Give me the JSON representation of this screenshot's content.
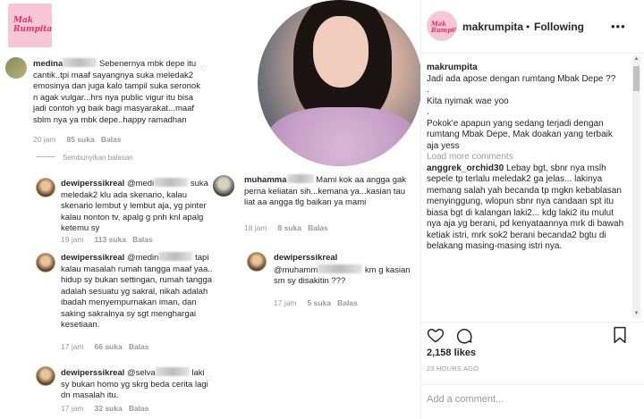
{
  "brand": {
    "logo_text": "Mak Rumpita",
    "pink": "#f7c6d6",
    "accent": "#e0306b"
  },
  "left_comments": [
    {
      "user": "medina",
      "text": "Sebenernya mbk depe itu cantik..tpi maaf sayangnya suka meledak2 emosinya dan juga kalo tampil suka seronok n agak vulgar...hrs nya public vigur itu bisa jadi contoh yg baik bagi masyarakat...maaf sblm nya ya mbk depe..happy ramadhan",
      "time": "20 jam",
      "likes": "85 suka",
      "reply": "Balas"
    },
    {
      "user": "dewiperssikreal",
      "mention": "@medi",
      "text": "suka meledak2 klu ada skenario, kalau skenario lembut y lembut aja, yg pinter kalau nonton tv, apalg g pnh knl apalg ketemu sy",
      "time": "19 jam",
      "likes": "113 suka",
      "reply": "Balas"
    },
    {
      "user": "dewiperssikreal",
      "mention": "@medin",
      "text": "tapi kalau masalah rumah tangga maaf yaa.. hidup sy bukan settingan, rumah tangga adalah sesuatu yg sakral, nikah adalah ibadah menyempurnakan iman, dan saking sakralnya sy sgt menghargai kesetiaan.",
      "time": "17 jam",
      "likes": "66 suka",
      "reply": "Balas"
    },
    {
      "user": "dewiperssikreal",
      "mention": "@selva",
      "text": "laki sy bukan homo yg skrg beda cerita lagi dn masalah itu.",
      "time": "17 jam",
      "likes": "32 suka",
      "reply": "Balas"
    }
  ],
  "hide_replies": "Sembunyikan balasan",
  "middle_comments": [
    {
      "user": "muhamma",
      "text": "Mami kok aa angga gak perna keliatan sih...kemana ya...kasian tau liat aa angga tlg baikan ya mami",
      "time": "18 jam",
      "likes": "8 suka",
      "reply": "Balas"
    },
    {
      "user": "dewiperssikreal",
      "mention": "@muhamm",
      "text": "km g kasian sm sy disakitin ???",
      "time": "17 jam",
      "likes": "5 suka",
      "reply": "Balas"
    }
  ],
  "post": {
    "username": "makrumpita",
    "separator": "•",
    "follow_state": "Following",
    "more": "•••",
    "caption_user": "makrumpita",
    "caption_lines": [
      "Jadi ada apose dengan rumtang Mbak Depe ??",
      ".",
      "Kita nyimak wae yoo",
      ".",
      "Pokok'e apapun yang sedang terjadi dengan rumtang Mbak Depe, Mak doakan yang terbaik aja yess"
    ],
    "load_more": "Load more comments",
    "comment_user": "anggrek_orchid30",
    "comment_text": "Lebay bgt, sbnr nya mslh sepele tp terlalu meledak2 ga jelas... lakinya memang salah yah becanda tp mgkn kebablasan menyinggung, wlopun sbnr nya candaan spt itu biasa bgt di kalangan laki2... kdg laki2 itu mulut nya aja yg berani, pd kenyataannya mrk di bawah ketiak istri, mrk sok2 berani becanda2 bgtu di",
    "comment_cut": "belakang masing-masing istri nya.",
    "likes": "2,158 likes",
    "time_ago": "23 HOURS AGO",
    "add_comment_placeholder": "Add a comment..."
  }
}
